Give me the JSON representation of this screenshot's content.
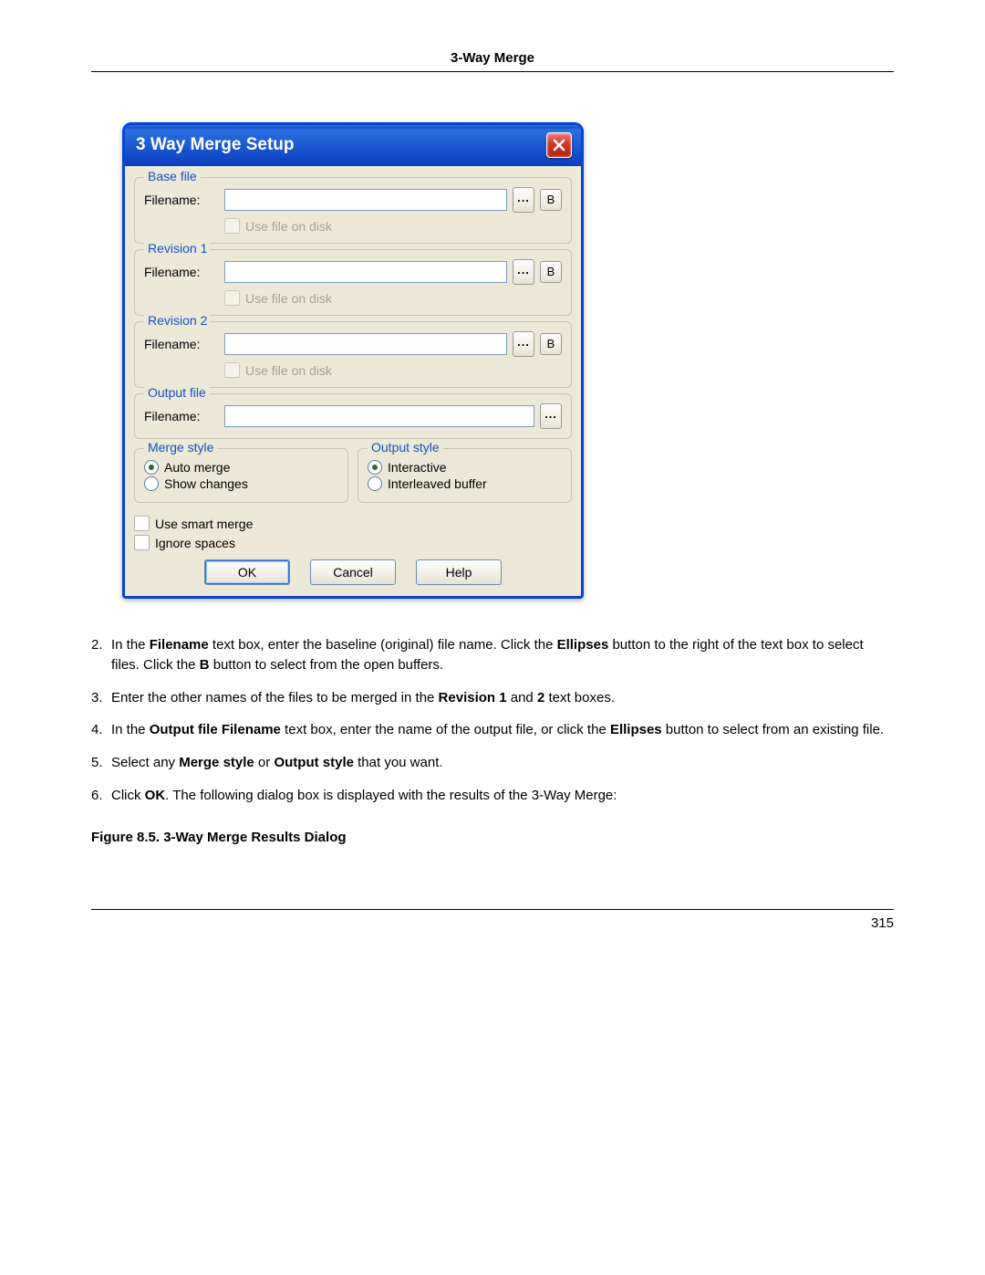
{
  "header": {
    "title": "3-Way Merge"
  },
  "dialog": {
    "title": "3 Way Merge Setup",
    "groups": {
      "base": {
        "legend": "Base file",
        "filename_label": "Filename:",
        "use_disk_label": "Use file on disk",
        "value": "",
        "browse": "...",
        "buf": "B"
      },
      "rev1": {
        "legend": "Revision 1",
        "filename_label": "Filename:",
        "use_disk_label": "Use file on disk",
        "value": "",
        "browse": "...",
        "buf": "B"
      },
      "rev2": {
        "legend": "Revision 2",
        "filename_label": "Filename:",
        "use_disk_label": "Use file on disk",
        "value": "",
        "browse": "...",
        "buf": "B"
      },
      "output": {
        "legend": "Output file",
        "filename_label": "Filename:",
        "value": "",
        "browse": "..."
      }
    },
    "merge_style": {
      "legend": "Merge style",
      "auto": "Auto merge",
      "show": "Show changes"
    },
    "output_style": {
      "legend": "Output style",
      "interactive": "Interactive",
      "interleaved": "Interleaved buffer"
    },
    "smart_merge": "Use smart merge",
    "ignore_spaces": "Ignore spaces",
    "buttons": {
      "ok": "OK",
      "cancel": "Cancel",
      "help": "Help"
    }
  },
  "steps": {
    "s2": {
      "num": "2.",
      "pre": "In the ",
      "b1": "Filename",
      "mid1": " text box, enter the baseline (original) file name. Click the ",
      "b2": "Ellipses",
      "mid2": " button to the right of the text box to select files. Click the ",
      "b3": "B",
      "post": " button to select from the open buffers."
    },
    "s3": {
      "num": "3.",
      "pre": "Enter the other names of the files to be merged in the ",
      "b1": "Revision 1",
      "mid": " and ",
      "b2": "2",
      "post": " text boxes."
    },
    "s4": {
      "num": "4.",
      "pre": "In the ",
      "b1": "Output file Filename",
      "mid": " text box, enter the name of the output file, or click the ",
      "b2": "Ellipses",
      "post": " button to select from an existing file."
    },
    "s5": {
      "num": "5.",
      "pre": "Select any ",
      "b1": "Merge style",
      "mid": " or ",
      "b2": "Output style",
      "post": " that you want."
    },
    "s6": {
      "num": "6.",
      "pre": "Click ",
      "b1": "OK",
      "post": ". The following dialog box is displayed with the results of the 3-Way Merge:"
    }
  },
  "figure_caption": "Figure 8.5.  3-Way Merge Results Dialog",
  "page_number": "315"
}
